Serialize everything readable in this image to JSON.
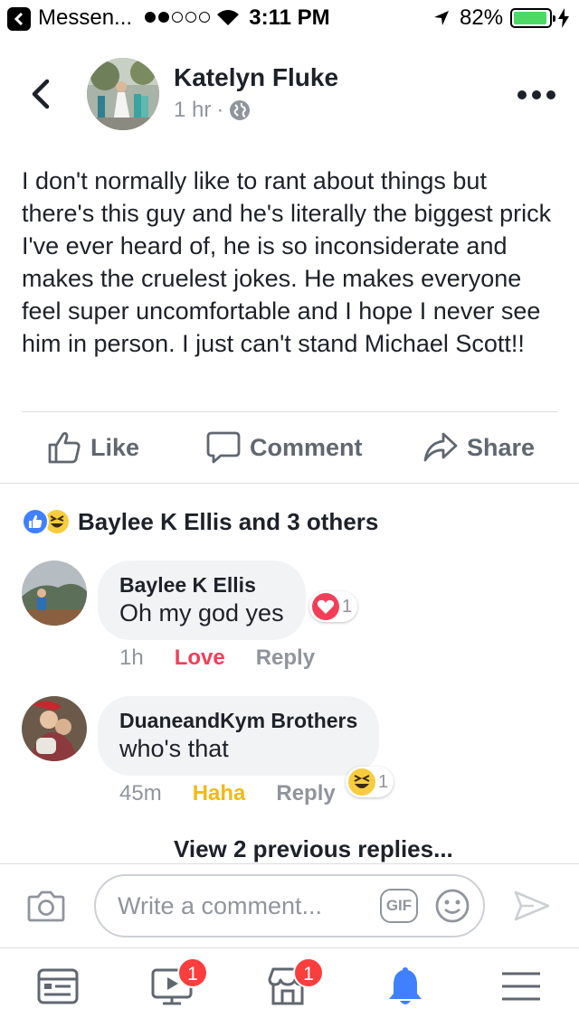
{
  "status_bar": {
    "back_app": "Messen...",
    "time": "3:11 PM",
    "battery": "82%",
    "battery_level": 0.82
  },
  "post": {
    "author": "Katelyn Fluke",
    "time": "1 hr",
    "separator": "·",
    "privacy_icon": "globe-icon",
    "body": "I don't normally like to rant about things but there's this guy and he's literally the biggest prick I've ever heard of, he is so inconsiderate and makes the cruelest jokes. He makes everyone feel super uncomfortable and I hope I never see him in person. I just can't stand Michael Scott!!"
  },
  "actions": {
    "like": "Like",
    "comment": "Comment",
    "share": "Share"
  },
  "reactions": {
    "summary": "Baylee K Ellis and 3 others",
    "types": [
      "like",
      "haha"
    ]
  },
  "comments": [
    {
      "author": "Baylee K Ellis",
      "text": "Oh my god yes",
      "time": "1h",
      "reaction_label": "Love",
      "reaction_color": "#f33e58",
      "reply": "Reply",
      "reaction_count": "1"
    },
    {
      "author": "DuaneandKym Brothers",
      "text": "who's that",
      "time": "45m",
      "reaction_label": "Haha",
      "reaction_color": "#f0ba15",
      "reply": "Reply",
      "reaction_count": "1"
    }
  ],
  "view_previous": "View 2 previous replies...",
  "composer": {
    "placeholder": "Write a comment...",
    "gif": "GIF"
  },
  "tabbar": {
    "watch_badge": "1",
    "marketplace_badge": "1",
    "active_tab": "notifications",
    "accent": "#4080ff"
  }
}
